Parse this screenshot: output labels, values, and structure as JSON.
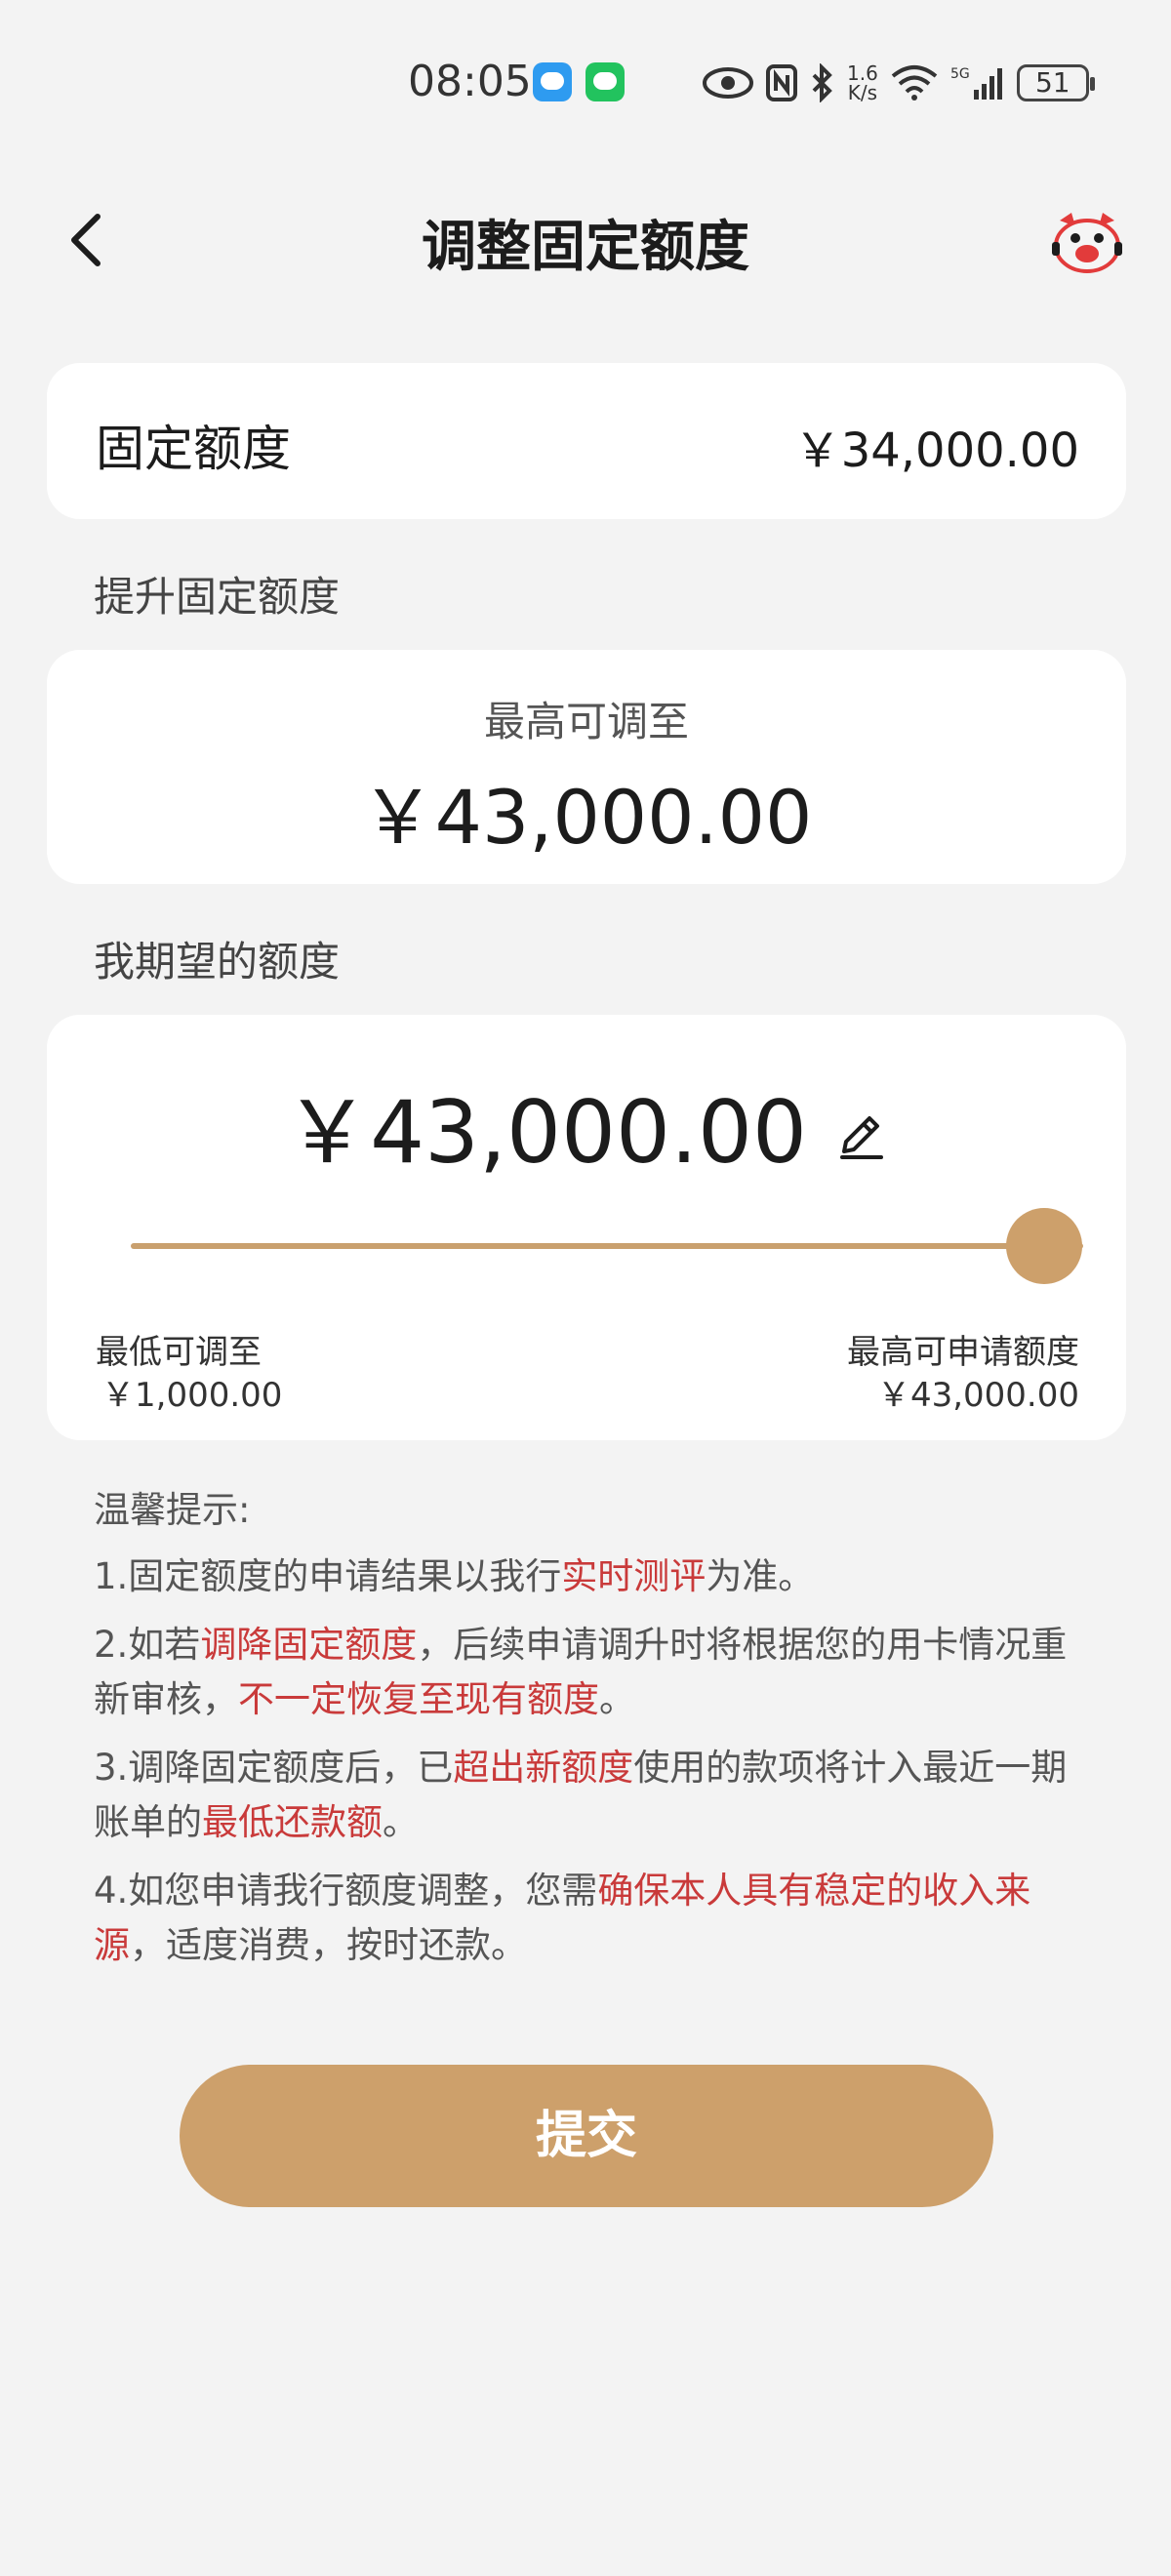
{
  "status_bar": {
    "time": "08:05",
    "network_speed_value": "1.6",
    "network_speed_unit": "K/s",
    "network_label": "5G",
    "battery": "51"
  },
  "header": {
    "title": "调整固定额度"
  },
  "fixed_limit": {
    "label": "固定额度",
    "value": "￥34,000.00"
  },
  "raise_section": {
    "title": "提升固定额度",
    "max_label": "最高可调至",
    "max_value": "￥43,000.00"
  },
  "expect_section": {
    "title": "我期望的额度",
    "value": "￥43,000.00",
    "slider_level": 1.0,
    "min_label": "最低可调至",
    "min_value": "￥1,000.00",
    "max_label": "最高可申请额度",
    "max_value": "￥43,000.00"
  },
  "tips": {
    "title": "温馨提示:",
    "t1_a": "1.固定额度的申请结果以我行",
    "t1_b": "实时测评",
    "t1_c": "为准。",
    "t2_a": "2.如若",
    "t2_b": "调降固定额度",
    "t2_c": "，后续申请调升时将根据您的用卡情况重新审核，",
    "t2_d": "不一定恢复至现有额度",
    "t2_e": "。",
    "t3_a": "3.调降固定额度后，已",
    "t3_b": "超出新额度",
    "t3_c": "使用的款项将计入最近一期账单的",
    "t3_d": "最低还款额",
    "t3_e": "。",
    "t4_a": "4.如您申请我行额度调整，您需",
    "t4_b": "确保本人具有稳定的收入来源",
    "t4_c": "，适度消费，按时还款。"
  },
  "submit": {
    "label": "提交"
  },
  "colors": {
    "accent": "#cda06b",
    "highlight_red": "#c93a3a",
    "background": "#f3f3f3"
  },
  "icons": [
    "back-arrow-icon",
    "mascot-icon",
    "edit-pencil-icon",
    "message-app-icon",
    "wechat-icon",
    "eye-icon",
    "nfc-icon",
    "bluetooth-icon",
    "wifi-icon",
    "signal-icon",
    "battery-icon"
  ]
}
